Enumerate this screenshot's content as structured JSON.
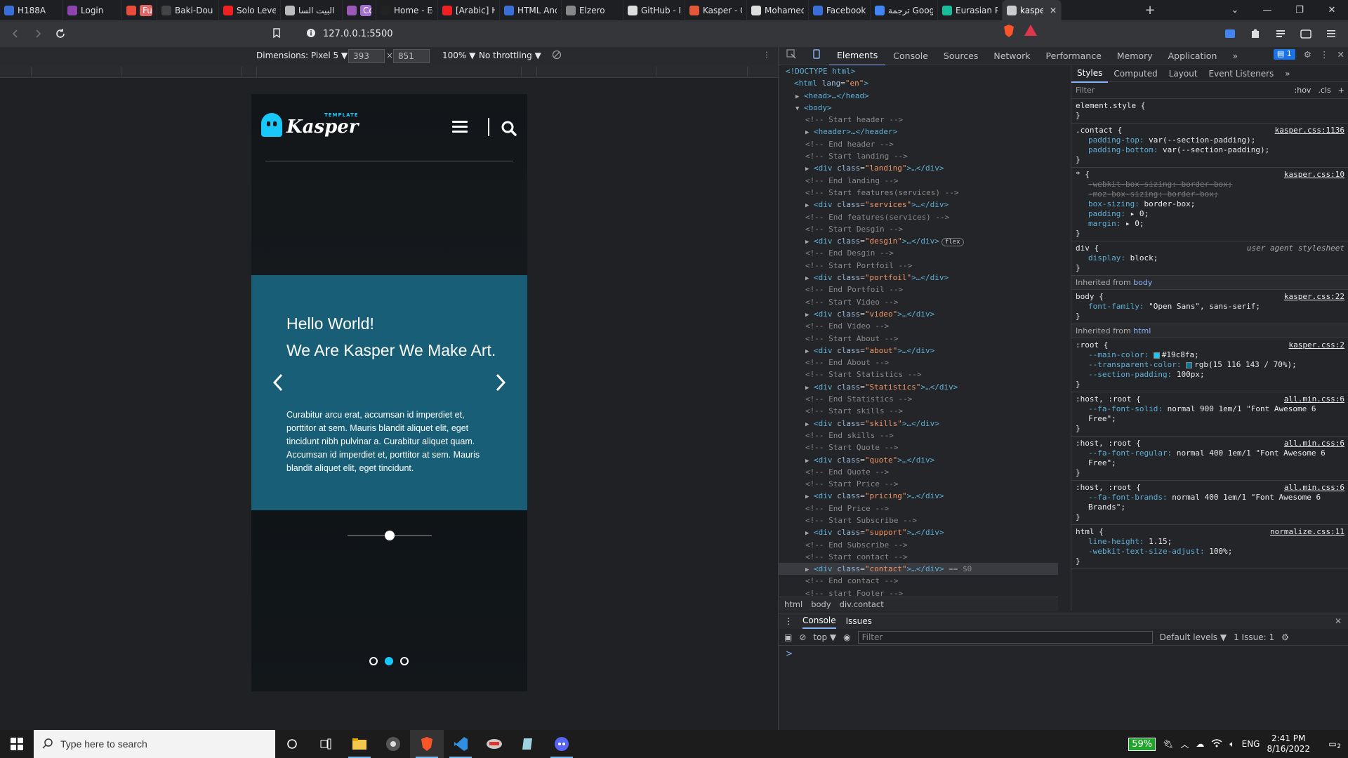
{
  "browser": {
    "tabs": [
      {
        "label": "H188A",
        "fav": "#3b6fd8",
        "w": 90
      },
      {
        "label": "Login",
        "fav": "#8e44ad",
        "w": 84
      },
      {
        "label": "Funzone",
        "fav": "#e74c3c",
        "badge": "#e06666",
        "w": 50
      },
      {
        "label": "Baki-Dou (",
        "fav": "#444",
        "w": 88
      },
      {
        "label": "Solo Leveli",
        "fav": "#e22",
        "w": 88
      },
      {
        "label": "البيت السا",
        "fav": "#bbb",
        "w": 88
      },
      {
        "label": "Coding",
        "fav": "#9b59b6",
        "badge": "#a46fd1",
        "w": 48
      },
      {
        "label": "Home - Eg",
        "fav": "#222",
        "w": 88
      },
      {
        "label": "[Arabic] H",
        "fav": "#e22",
        "w": 88
      },
      {
        "label": "HTML And",
        "fav": "#3b6fd8",
        "w": 88
      },
      {
        "label": "Elzero",
        "fav": "#888",
        "w": 88
      },
      {
        "label": "GitHub - E",
        "fav": "#ddd",
        "w": 88
      },
      {
        "label": "Kasper - O",
        "fav": "#e05a3a",
        "w": 88
      },
      {
        "label": "Mohamed",
        "fav": "#ddd",
        "w": 88
      },
      {
        "label": "Facebook",
        "fav": "#3b6fd8",
        "w": 88
      },
      {
        "label": "ترجمة Google",
        "fav": "#4285f4",
        "w": 96
      },
      {
        "label": "Eurasian P",
        "fav": "#1abc9c",
        "w": 92
      },
      {
        "label": "kasper",
        "fav": "#ccc",
        "w": 84,
        "active": true
      }
    ],
    "new_tab": "+",
    "url": "127.0.0.1:5500",
    "window_controls": [
      "⌄",
      "—",
      "❐",
      "✕"
    ]
  },
  "device_toolbar": {
    "dimensions_label": "Dimensions: Pixel 5 ▼",
    "width": "393",
    "height": "851",
    "times": "×",
    "zoom": "100% ▼",
    "throttling": "No throttling ▼"
  },
  "page": {
    "logo_word": "Kasper",
    "logo_tag": "TEMPLATE",
    "heading_line1": "Hello World!",
    "heading_line2": "We Are Kasper We Make Art.",
    "paragraph": "Curabitur arcu erat, accumsan id imperdiet et, porttitor at sem. Mauris blandit aliquet elit, eget tincidunt nibh pulvinar a. Curabitur aliquet quam. Accumsan id imperdiet et, porttitor at sem. Mauris blandit aliquet elit, eget tincidunt.",
    "prev_arrow": "‹",
    "next_arrow": "›",
    "active_dot": 2
  },
  "devtools": {
    "tabs": [
      "Elements",
      "Console",
      "Sources",
      "Network",
      "Performance",
      "Memory",
      "Application",
      "»"
    ],
    "issues_badge": "1",
    "dom_lines": [
      {
        "i": 0,
        "t": "plain",
        "text": "<!DOCTYPE html>"
      },
      {
        "i": 0,
        "t": "open",
        "tag": "html",
        "attr": "lang",
        "val": "\"en\"",
        "tail": ">"
      },
      {
        "i": 1,
        "t": "col",
        "tag": "head",
        "tail": ">…</head>"
      },
      {
        "i": 1,
        "t": "exp",
        "tag": "body",
        "tail": ">"
      },
      {
        "i": 2,
        "t": "cm",
        "text": "<!-- Start header -->"
      },
      {
        "i": 2,
        "t": "col",
        "tag": "header",
        "tail": ">…</header>"
      },
      {
        "i": 2,
        "t": "cm",
        "text": "<!-- End header -->"
      },
      {
        "i": 2,
        "t": "cm",
        "text": "<!-- Start landing -->"
      },
      {
        "i": 2,
        "t": "div",
        "val": "\"landing\""
      },
      {
        "i": 2,
        "t": "cm",
        "text": "<!-- End landing -->"
      },
      {
        "i": 2,
        "t": "cm",
        "text": "<!-- Start features(services) -->"
      },
      {
        "i": 2,
        "t": "div",
        "val": "\"services\""
      },
      {
        "i": 2,
        "t": "cm",
        "text": "<!-- End features(services) -->"
      },
      {
        "i": 2,
        "t": "cm",
        "text": "<!-- Start Desgin -->"
      },
      {
        "i": 2,
        "t": "div",
        "val": "\"desgin\"",
        "flex": "flex"
      },
      {
        "i": 2,
        "t": "cm",
        "text": "<!-- End Desgin -->"
      },
      {
        "i": 2,
        "t": "cm",
        "text": "<!-- Start Portfoil -->"
      },
      {
        "i": 2,
        "t": "div",
        "val": "\"portfoil\""
      },
      {
        "i": 2,
        "t": "cm",
        "text": "<!-- End Portfoil -->"
      },
      {
        "i": 2,
        "t": "cm",
        "text": "<!-- Start Video -->"
      },
      {
        "i": 2,
        "t": "div",
        "val": "\"video\""
      },
      {
        "i": 2,
        "t": "cm",
        "text": "<!-- End Video -->"
      },
      {
        "i": 2,
        "t": "cm",
        "text": "<!-- Start About -->"
      },
      {
        "i": 2,
        "t": "div",
        "val": "\"about\""
      },
      {
        "i": 2,
        "t": "cm",
        "text": "<!-- End About -->"
      },
      {
        "i": 2,
        "t": "cm",
        "text": "<!-- Start Statistics  -->"
      },
      {
        "i": 2,
        "t": "div",
        "val": "\"Statistics\""
      },
      {
        "i": 2,
        "t": "cm",
        "text": "<!-- End Statistics  -->"
      },
      {
        "i": 2,
        "t": "cm",
        "text": "<!-- Start skills -->"
      },
      {
        "i": 2,
        "t": "div",
        "val": "\"skills\""
      },
      {
        "i": 2,
        "t": "cm",
        "text": "<!-- End skills -->"
      },
      {
        "i": 2,
        "t": "cm",
        "text": "<!-- Start Quote  -->"
      },
      {
        "i": 2,
        "t": "div",
        "val": "\"quote\""
      },
      {
        "i": 2,
        "t": "cm",
        "text": "<!-- End Quote  -->"
      },
      {
        "i": 2,
        "t": "cm",
        "text": "<!-- Start Price -->"
      },
      {
        "i": 2,
        "t": "div",
        "val": "\"pricing\""
      },
      {
        "i": 2,
        "t": "cm",
        "text": "<!-- End Price -->"
      },
      {
        "i": 2,
        "t": "cm",
        "text": "<!-- Start Subscribe -->"
      },
      {
        "i": 2,
        "t": "div",
        "val": "\"support\""
      },
      {
        "i": 2,
        "t": "cm",
        "text": "<!-- End Subscribe  -->"
      },
      {
        "i": 2,
        "t": "cm",
        "text": "<!-- Start contact -->"
      },
      {
        "i": 2,
        "t": "div",
        "val": "\"contact\"",
        "sel": true,
        "suffix": " == $0"
      },
      {
        "i": 2,
        "t": "cm",
        "text": "<!-- End contact -->"
      },
      {
        "i": 2,
        "t": "cm",
        "text": "<!-- start Footer -->"
      }
    ],
    "breadcrumbs": [
      "html",
      "body",
      "div.contact"
    ],
    "styles_tabs": [
      "Styles",
      "Computed",
      "Layout",
      "Event Listeners",
      "»"
    ],
    "styles_filter": "Filter",
    "styles_filter_opts": [
      ":hov",
      ".cls",
      "+"
    ],
    "rules": [
      {
        "sel": "element.style {",
        "props": []
      },
      {
        "sel": ".contact {",
        "src": "kasper.css:1136",
        "props": [
          [
            "padding-top",
            "var(--section-padding);"
          ],
          [
            "padding-bottom",
            "var(--section-padding);"
          ]
        ]
      },
      {
        "sel": "* {",
        "src": "kasper.css:10",
        "props": [
          [
            "-webkit-box-sizing",
            "border-box;",
            "strike"
          ],
          [
            "-moz-box-sizing",
            "border-box;",
            "strike"
          ],
          [
            "box-sizing",
            "border-box;"
          ],
          [
            "padding",
            "▸ 0;"
          ],
          [
            "margin",
            "▸ 0;"
          ]
        ]
      },
      {
        "sel": "div {",
        "ua": "user agent stylesheet",
        "props": [
          [
            "display",
            "block;"
          ]
        ]
      },
      {
        "inherit": "body"
      },
      {
        "sel": "body {",
        "src": "kasper.css:22",
        "props": [
          [
            "font-family",
            "\"Open Sans\", sans-serif;"
          ]
        ]
      },
      {
        "inherit": "html"
      },
      {
        "sel": ":root {",
        "src": "kasper.css:2",
        "props": [
          [
            "--main-color",
            "#19c8fa;",
            "",
            "#19c8fa"
          ],
          [
            "--transparent-color",
            "rgb(15 116 143 / 70%);",
            "",
            "#0f748f"
          ],
          [
            "--section-padding",
            "100px;"
          ]
        ]
      },
      {
        "sel": ":host, :root {",
        "src": "all.min.css:6",
        "props": [
          [
            "--fa-font-solid",
            "normal 900 1em/1 \"Font Awesome 6 Free\";"
          ]
        ]
      },
      {
        "sel": ":host, :root {",
        "src": "all.min.css:6",
        "props": [
          [
            "--fa-font-regular",
            "normal 400 1em/1 \"Font Awesome 6 Free\";"
          ]
        ]
      },
      {
        "sel": ":host, :root {",
        "src": "all.min.css:6",
        "props": [
          [
            "--fa-font-brands",
            "normal 400 1em/1 \"Font Awesome 6 Brands\";"
          ]
        ]
      },
      {
        "sel": "html {",
        "src": "normalize.css:11",
        "props": [
          [
            "line-height",
            "1.15;"
          ],
          [
            "-webkit-text-size-adjust",
            "100%;"
          ]
        ]
      }
    ],
    "drawer_tabs": [
      "Console",
      "Issues"
    ],
    "console_context": "top ▼",
    "console_filter": "Filter",
    "console_levels": "Default levels ▼",
    "console_issues": "1 Issue: 1",
    "prompt": ">"
  },
  "taskbar": {
    "search_placeholder": "Type here to search",
    "battery": "59%",
    "lang": "ENG",
    "time": "2:41 PM",
    "date": "8/16/2022",
    "notif": "2"
  },
  "colors": {
    "main": "#19c8fa",
    "transparent": "#0f748f"
  }
}
